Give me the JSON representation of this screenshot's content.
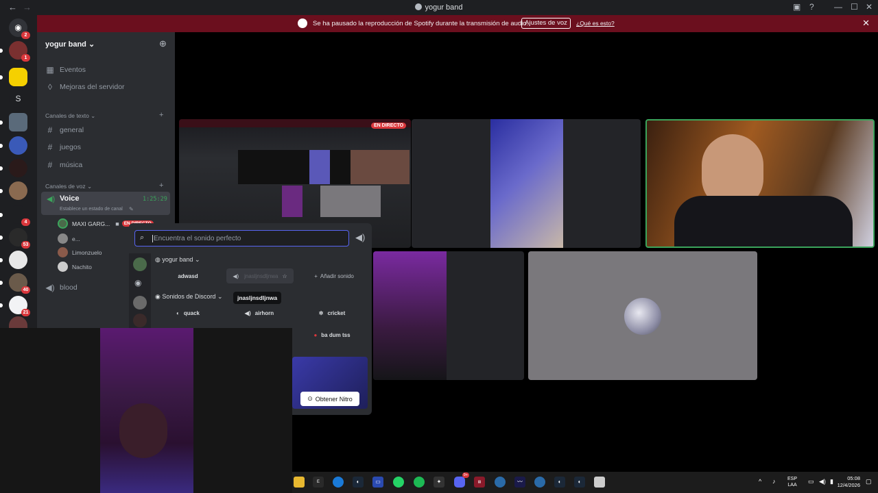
{
  "window": {
    "title": "yogur band"
  },
  "banner": {
    "message": "Se ha pausado la reproducción de Spotify durante la transmisión de audio.",
    "button": "Ajustes de voz",
    "link": "¿Qué es esto?"
  },
  "rail": {
    "badges": [
      "2",
      "1",
      "4",
      "53",
      "40",
      "21"
    ],
    "letter": "S"
  },
  "sidebar": {
    "server_name": "yogur band",
    "events": "Eventos",
    "boosts": "Mejoras del servidor",
    "text_category": "Canales de texto",
    "text_channels": [
      "general",
      "juegos",
      "música"
    ],
    "voice_category": "Canales de voz",
    "voice_channel": "Voice",
    "voice_timer": "1:25:29",
    "voice_status": "Establece un estado de canal",
    "voice_users": [
      "MAXI GARG...",
      "e...",
      "Limonzuelo",
      "Nachito"
    ],
    "live_badge": "EN DIRECTO",
    "other_channel": "blood"
  },
  "stream": {
    "live_badge": "EN DIRECTO"
  },
  "soundboard": {
    "search_placeholder": "Encuentra el sonido perfecto",
    "group1": "yogur band",
    "group1_sounds": [
      "adwasd",
      "jnasljnsdljnwa"
    ],
    "add_sound": "Añadir sonido",
    "tooltip": "jnasljnsdljnwa",
    "group2": "Sonidos de Discord",
    "group2_sounds": [
      "quack",
      "airhorn",
      "cricket",
      "ba dum tss"
    ],
    "nitro_button": "Obtener Nitro"
  },
  "taskbar": {
    "lang_top": "ESP",
    "lang_bottom": "LAA",
    "time": "05:08",
    "date": "12/4/2026",
    "discord_badge": "9+"
  },
  "colors": {
    "banner": "#6b0f1e",
    "accent": "#5865f2",
    "live": "#da373c",
    "speaking": "#3ba55c"
  }
}
